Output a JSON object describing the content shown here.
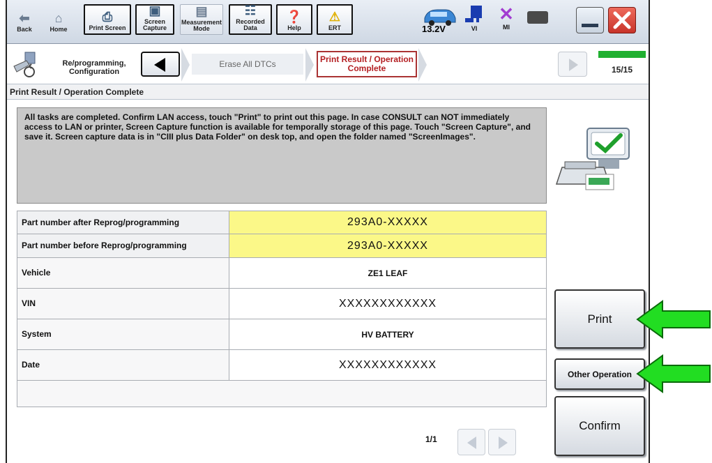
{
  "toolbar": {
    "back": "Back",
    "home": "Home",
    "print_screen": "Print Screen",
    "screen_capture": "Screen Capture",
    "measurement_mode": "Measurement Mode",
    "recorded_data": "Recorded Data",
    "help": "Help",
    "ert": "ERT",
    "voltage": "13.2V",
    "vi": "VI",
    "mi": "MI"
  },
  "breadcrumb": {
    "section": "Re/programming, Configuration",
    "prev_step": "Erase All DTCs",
    "current_step": "Print Result / Operation Complete",
    "page_count": "15/15",
    "progress_fraction": 1.0
  },
  "page_title": "Print Result / Operation Complete",
  "message": "All tasks are completed. Confirm LAN access, touch \"Print\" to print out this page. In case CONSULT can NOT immediately access to LAN or printer, Screen Capture function is available for temporally storage of this page. Touch \"Screen Capture\", and save it. Screen capture data is in \"CIII plus Data Folder\" on desk top, and open the folder named \"ScreenImages\".",
  "table": {
    "rows": [
      {
        "label": "Part number after Reprog/programming",
        "value": "293A0-XXXXX"
      },
      {
        "label": "Part number before Reprog/programming",
        "value": "293A0-XXXXX"
      },
      {
        "label": "Vehicle",
        "value": "ZE1 LEAF"
      },
      {
        "label": "VIN",
        "value": "XXXXXXXXXXXX"
      },
      {
        "label": "System",
        "value": "HV BATTERY"
      },
      {
        "label": "Date",
        "value": "XXXXXXXXXXXX"
      }
    ]
  },
  "pager": {
    "text": "1/1"
  },
  "buttons": {
    "print": "Print",
    "other_operation": "Other Operation",
    "confirm": "Confirm"
  },
  "colors": {
    "highlight": "#fbf888",
    "current_step_border": "#aa3333",
    "progress": "#20b030",
    "arrow": "#22dd22"
  }
}
